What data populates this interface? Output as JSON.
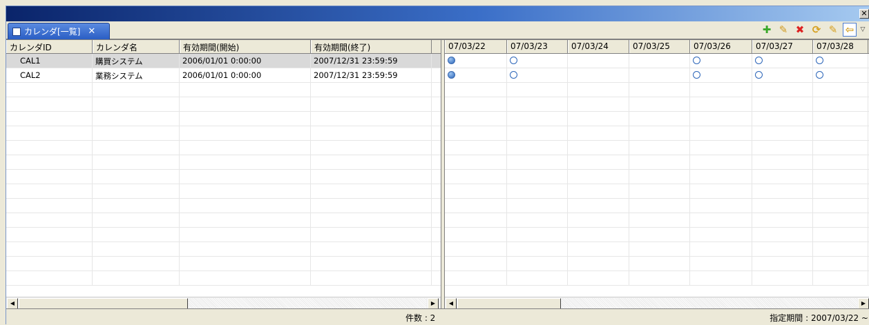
{
  "window": {
    "close_glyph": "✕"
  },
  "tab": {
    "label": "カレンダ[一覧]",
    "close_glyph": "✕"
  },
  "toolbar": {
    "add_glyph": "✚",
    "edit_glyph": "✎",
    "delete_glyph": "✖",
    "refresh_glyph": "⟳",
    "filter_glyph": "✎",
    "back_glyph": "⇦",
    "menu_glyph": "▽"
  },
  "list": {
    "columns": [
      "カレンダID",
      "カレンダ名",
      "有効期間(開始)",
      "有効期間(終了)"
    ],
    "rows": [
      [
        "CAL1",
        "購買システム",
        "2006/01/01 0:00:00",
        "2007/12/31 23:59:59"
      ],
      [
        "CAL2",
        "業務システム",
        "2006/01/01 0:00:00",
        "2007/12/31 23:59:59"
      ]
    ]
  },
  "calendar": {
    "dates": [
      "07/03/22",
      "07/03/23",
      "07/03/24",
      "07/03/25",
      "07/03/26",
      "07/03/27",
      "07/03/28"
    ],
    "marks": [
      [
        "full",
        "empty",
        "",
        "",
        "empty",
        "empty",
        "empty"
      ],
      [
        "full",
        "empty",
        "",
        "",
        "empty",
        "empty",
        "empty"
      ]
    ]
  },
  "status": {
    "count": "件数 : 2",
    "period": "指定期間 : 2007/03/22 ~"
  },
  "scrollbar": {
    "left_arrow": "◀",
    "right_arrow": "▶"
  }
}
